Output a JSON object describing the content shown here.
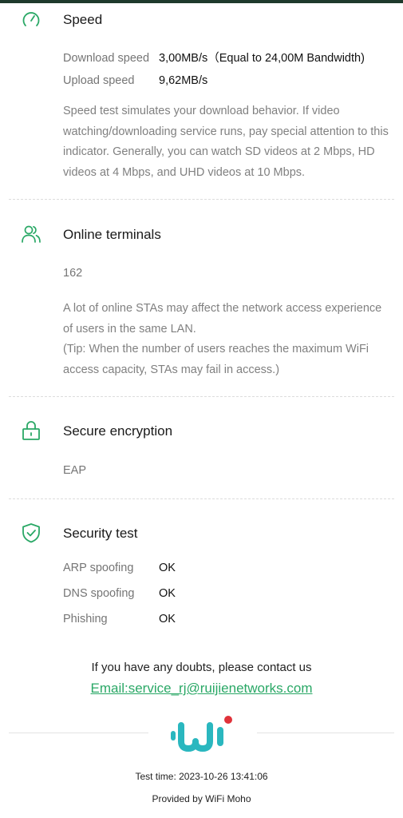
{
  "speed": {
    "title": "Speed",
    "download_label": "Download speed",
    "download_value": "3,00MB/s（Equal to 24,00M Bandwidth)",
    "upload_label": "Upload speed",
    "upload_value": "9,62MB/s",
    "description": "Speed test simulates your download behavior. If video watching/downloading service runs, pay special attention to this indicator. Generally, you can watch SD videos at 2 Mbps, HD videos at 4 Mbps, and UHD videos at 10 Mbps."
  },
  "terminals": {
    "title": "Online terminals",
    "count": "162",
    "description": "A lot of online STAs may affect the network access experience of users in the same LAN.",
    "tip": "(Tip: When the number of users reaches the maximum WiFi access capacity, STAs may fail in access.)"
  },
  "encryption": {
    "title": "Secure encryption",
    "value": "EAP"
  },
  "security": {
    "title": "Security test",
    "items": [
      {
        "label": "ARP spoofing",
        "value": "OK"
      },
      {
        "label": "DNS spoofing",
        "value": "OK"
      },
      {
        "label": "Phishing",
        "value": "OK"
      }
    ]
  },
  "contact": {
    "text": "If you have any doubts, please contact us",
    "email": "Email:service_rj@ruijienetworks.com"
  },
  "footer": {
    "test_time": "Test time: 2023-10-26 13:41:06",
    "provided_by": "Provided by WiFi Moho"
  },
  "colors": {
    "accent": "#2aa866",
    "logo_teal": "#2ab7bf",
    "logo_red": "#e0323a"
  }
}
